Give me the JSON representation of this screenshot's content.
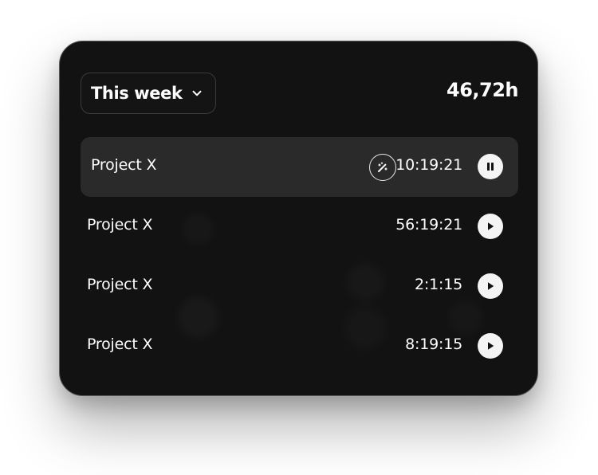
{
  "header": {
    "period_label": "This week",
    "period_icon": "chevron-down-icon",
    "total_hours": "46,72h"
  },
  "projects": [
    {
      "name": "Project X",
      "time": "10:19:21",
      "status": "running",
      "action_icon": "pause-icon",
      "extra_icon": "magic-wand-icon"
    },
    {
      "name": "Project X",
      "time": "56:19:21",
      "status": "stopped",
      "action_icon": "play-icon"
    },
    {
      "name": "Project X",
      "time": "2:1:15",
      "status": "stopped",
      "action_icon": "play-icon"
    },
    {
      "name": "Project X",
      "time": "8:19:15",
      "status": "stopped",
      "action_icon": "play-icon"
    }
  ],
  "colors": {
    "card_background": "#121212",
    "active_row_background": "#2a2a2a",
    "text": "#ffffff",
    "button_fill": "#f4f4f4",
    "border": "#3b3b3b"
  }
}
